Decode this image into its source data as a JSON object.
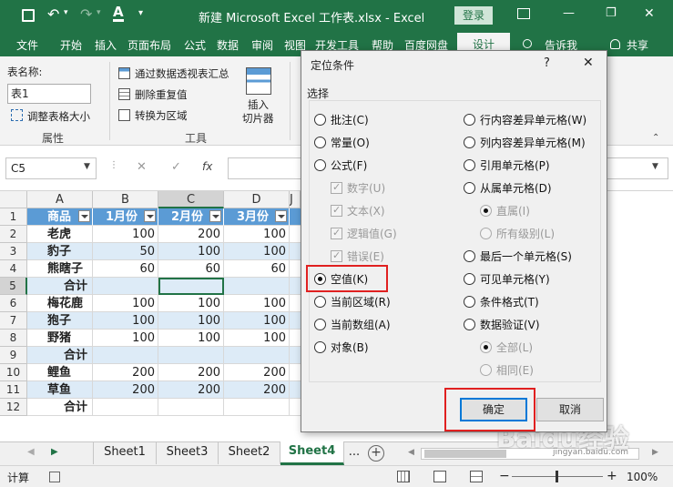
{
  "titlebar": {
    "title": "新建 Microsoft Excel 工作表.xlsx  -  Excel",
    "login": "登录",
    "min": "—",
    "restore": "❐",
    "close": "✕"
  },
  "ribbon_tabs": [
    "文件",
    "开始",
    "插入",
    "页面布局",
    "公式",
    "数据",
    "审阅",
    "视图",
    "开发工具",
    "帮助",
    "百度网盘",
    "设计"
  ],
  "tell_me": "告诉我",
  "share": "共享",
  "ribbon": {
    "table_name_label": "表名称:",
    "table_name_value": "表1",
    "resize_table": "调整表格大小",
    "group_properties": "属性",
    "pivot_summary": "通过数据透视表汇总",
    "remove_duplicates": "删除重复值",
    "convert_range": "转换为区域",
    "insert_slicer_1": "插入",
    "insert_slicer_2": "切片器",
    "group_tools": "工具"
  },
  "formula_bar": {
    "name_box": "C5",
    "fx": "fx",
    "cancel": "✕",
    "enter": "✓",
    "value": ""
  },
  "columns": [
    "A",
    "B",
    "C",
    "D",
    "J"
  ],
  "rows": [
    "1",
    "2",
    "3",
    "4",
    "5",
    "6",
    "7",
    "8",
    "9",
    "10",
    "11",
    "12"
  ],
  "table": [
    [
      "商品",
      "1月份",
      "2月份",
      "3月份"
    ],
    [
      "老虎",
      "100",
      "200",
      "100"
    ],
    [
      "豹子",
      "50",
      "100",
      "100"
    ],
    [
      "熊瞎子",
      "60",
      "60",
      "60"
    ],
    [
      "合计",
      "",
      "",
      ""
    ],
    [
      "梅花鹿",
      "100",
      "100",
      "100"
    ],
    [
      "狍子",
      "100",
      "100",
      "100"
    ],
    [
      "野猪",
      "100",
      "100",
      "100"
    ],
    [
      "合计",
      "",
      "",
      ""
    ],
    [
      "鲤鱼",
      "200",
      "200",
      "200"
    ],
    [
      "草鱼",
      "200",
      "200",
      "200"
    ],
    [
      "合计",
      "",
      "",
      ""
    ]
  ],
  "sheets": [
    "Sheet1",
    "Sheet3",
    "Sheet2",
    "Sheet4",
    "..."
  ],
  "status": {
    "mode": "计算",
    "zoom": "100%",
    "zoom_minus": "−",
    "zoom_plus": "+"
  },
  "dialog": {
    "title": "定位条件",
    "help": "?",
    "close": "✕",
    "section": "选择",
    "left_options": [
      {
        "label": "批注(C)",
        "type": "radio",
        "checked": false,
        "disabled": false
      },
      {
        "label": "常量(O)",
        "type": "radio",
        "checked": false,
        "disabled": false
      },
      {
        "label": "公式(F)",
        "type": "radio",
        "checked": false,
        "disabled": false
      },
      {
        "label": "数字(U)",
        "type": "check",
        "checked": true,
        "disabled": true
      },
      {
        "label": "文本(X)",
        "type": "check",
        "checked": true,
        "disabled": true
      },
      {
        "label": "逻辑值(G)",
        "type": "check",
        "checked": true,
        "disabled": true
      },
      {
        "label": "错误(E)",
        "type": "check",
        "checked": true,
        "disabled": true
      },
      {
        "label": "空值(K)",
        "type": "radio",
        "checked": true,
        "disabled": false
      },
      {
        "label": "当前区域(R)",
        "type": "radio",
        "checked": false,
        "disabled": false
      },
      {
        "label": "当前数组(A)",
        "type": "radio",
        "checked": false,
        "disabled": false
      },
      {
        "label": "对象(B)",
        "type": "radio",
        "checked": false,
        "disabled": false
      }
    ],
    "right_options": [
      {
        "label": "行内容差异单元格(W)",
        "type": "radio",
        "checked": false,
        "disabled": false
      },
      {
        "label": "列内容差异单元格(M)",
        "type": "radio",
        "checked": false,
        "disabled": false
      },
      {
        "label": "引用单元格(P)",
        "type": "radio",
        "checked": false,
        "disabled": false
      },
      {
        "label": "从属单元格(D)",
        "type": "radio",
        "checked": false,
        "disabled": false
      },
      {
        "label": "直属(I)",
        "type": "radio",
        "checked": true,
        "disabled": true
      },
      {
        "label": "所有级别(L)",
        "type": "radio",
        "checked": false,
        "disabled": true
      },
      {
        "label": "最后一个单元格(S)",
        "type": "radio",
        "checked": false,
        "disabled": false
      },
      {
        "label": "可见单元格(Y)",
        "type": "radio",
        "checked": false,
        "disabled": false
      },
      {
        "label": "条件格式(T)",
        "type": "radio",
        "checked": false,
        "disabled": false
      },
      {
        "label": "数据验证(V)",
        "type": "radio",
        "checked": false,
        "disabled": false
      },
      {
        "label": "全部(L)",
        "type": "radio",
        "checked": true,
        "disabled": true
      },
      {
        "label": "相同(E)",
        "type": "radio",
        "checked": false,
        "disabled": true
      }
    ],
    "ok": "确定",
    "cancel": "取消"
  },
  "watermark": "Baidu经验",
  "watermark_url": "jingyan.baidu.com"
}
